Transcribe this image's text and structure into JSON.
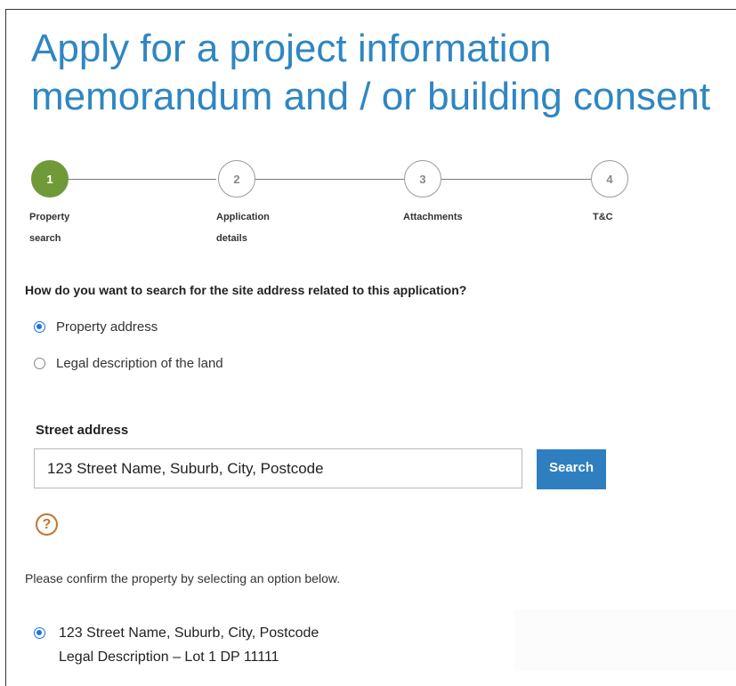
{
  "page": {
    "title": "Apply for a project information memorandum and / or building consent"
  },
  "stepper": {
    "steps": [
      {
        "number": "1",
        "label": "Property search",
        "active": true
      },
      {
        "number": "2",
        "label": "Application details",
        "active": false
      },
      {
        "number": "3",
        "label": "Attachments",
        "active": false
      },
      {
        "number": "4",
        "label": "T&C",
        "active": false
      }
    ]
  },
  "search_method": {
    "question": "How do you want to search for the site address related to this application?",
    "options": [
      {
        "label": "Property address",
        "selected": true
      },
      {
        "label": "Legal description of the land",
        "selected": false
      }
    ]
  },
  "street_address": {
    "label": "Street address",
    "value": "123 Street Name, Suburb, City, Postcode",
    "search_label": "Search",
    "help_glyph": "?"
  },
  "confirm": {
    "instruction": "Please confirm the property by selecting an option below.",
    "results": [
      {
        "address": "123 Street Name, Suburb, City, Postcode",
        "legal": "Legal Description – Lot 1 DP 11111",
        "selected": true
      }
    ]
  },
  "colors": {
    "title": "#2f86c2",
    "active_step": "#6f9a37",
    "button": "#2f7fc0",
    "help": "#c0762f",
    "radio": "#1a73e8"
  }
}
